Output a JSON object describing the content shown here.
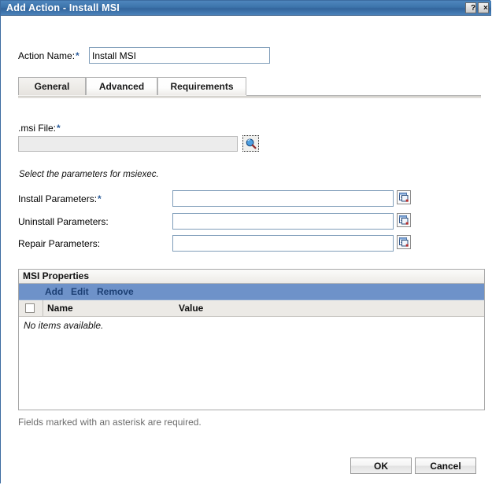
{
  "window": {
    "title": "Add Action - Install MSI",
    "help_button": "?",
    "close_button": "×",
    "titlebar_color": "#3d74ab"
  },
  "form": {
    "action_name": {
      "label": "Action Name:",
      "required_marker": "*",
      "value": "Install MSI",
      "placeholder": ""
    }
  },
  "tabs": [
    {
      "label": "General",
      "active": true
    },
    {
      "label": "Advanced",
      "active": false
    },
    {
      "label": "Requirements",
      "active": false
    }
  ],
  "general_tab": {
    "msi_file": {
      "label": ".msi File:",
      "required_marker": "*",
      "value": "",
      "placeholder": "",
      "browse_icon": "magnifier-icon"
    },
    "hint": "Select the parameters for msiexec.",
    "parameters": [
      {
        "label": "Install Parameters:",
        "required_marker": "*",
        "value": "",
        "placeholder": "",
        "picker_icon": "select-window-icon"
      },
      {
        "label": "Uninstall Parameters:",
        "required_marker": "",
        "value": "",
        "placeholder": "",
        "picker_icon": "select-window-icon"
      },
      {
        "label": "Repair Parameters:",
        "required_marker": "",
        "value": "",
        "placeholder": "",
        "picker_icon": "select-window-icon"
      }
    ],
    "msi_properties": {
      "caption": "MSI Properties",
      "toolbar": {
        "add": "Add",
        "edit": "Edit",
        "remove": "Remove",
        "background_color": "#6e92c9",
        "link_color": "#1c3f74"
      },
      "columns": [
        "Name",
        "Value"
      ],
      "rows": [],
      "empty_message": "No items available."
    }
  },
  "footer": {
    "note": "Fields marked with an asterisk are required.",
    "ok_label": "OK",
    "cancel_label": "Cancel"
  }
}
